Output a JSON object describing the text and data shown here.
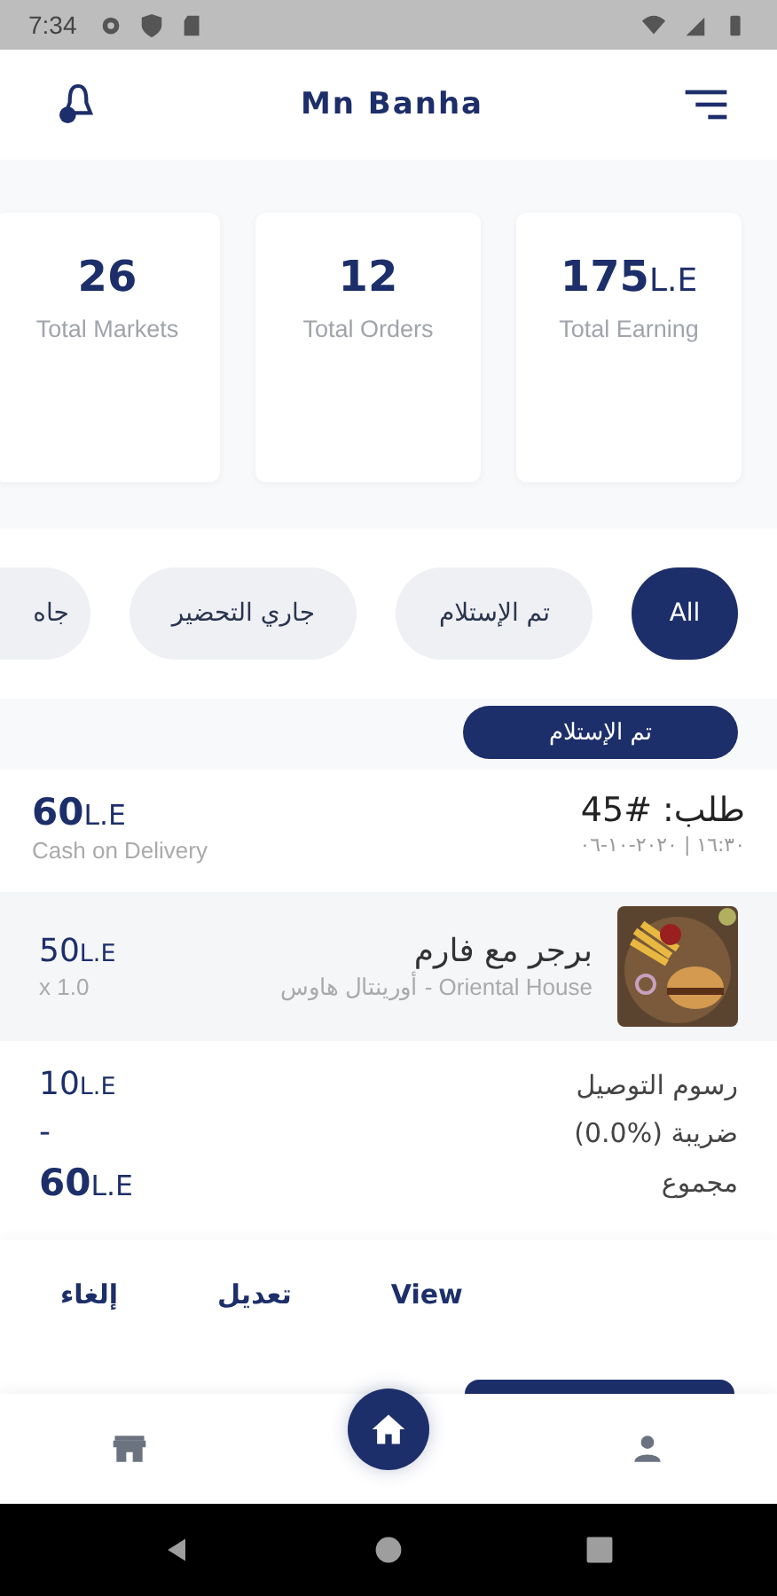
{
  "status_bar": {
    "time": "7:34"
  },
  "header": {
    "title": "Mn Banha"
  },
  "stats": [
    {
      "value": "175",
      "unit": "L.E",
      "label": "Total Earning"
    },
    {
      "value": "12",
      "label": "Total Orders"
    },
    {
      "value": "26",
      "label": "Total Markets"
    }
  ],
  "filters": [
    {
      "label": "All",
      "selected": true
    },
    {
      "label": "تم الإستلام",
      "selected": false
    },
    {
      "label": "جاري التحضير",
      "selected": false
    },
    {
      "label": "جاه",
      "selected": false
    }
  ],
  "order": {
    "status": "تم الإستلام",
    "number": "طلب: #45",
    "datetime": "١٦:٣٠ | ٢٠٢٠-١٠-٠٦",
    "total": "60",
    "total_unit": "L.E",
    "payment": "Cash on Delivery",
    "items": [
      {
        "name": "برجر مع فارم",
        "store": "Oriental House - أورينتال هاوس",
        "price": "50",
        "unit": "L.E",
        "quantity": "x 1.0"
      }
    ],
    "summary": [
      {
        "label": "رسوم التوصيل",
        "value": "10",
        "unit": "L.E",
        "kind": "fee"
      },
      {
        "label": "ضريبة (%0.0)",
        "value": "-",
        "kind": "fee"
      },
      {
        "label": "مجموع",
        "value": "60",
        "unit": "L.E",
        "kind": "total"
      }
    ],
    "actions": [
      "View",
      "تعديل",
      "إلغاء"
    ]
  },
  "bottom_nav": [
    {
      "kind": "store",
      "selected": false
    },
    {
      "kind": "home",
      "selected": true
    },
    {
      "kind": "person",
      "selected": false
    }
  ]
}
